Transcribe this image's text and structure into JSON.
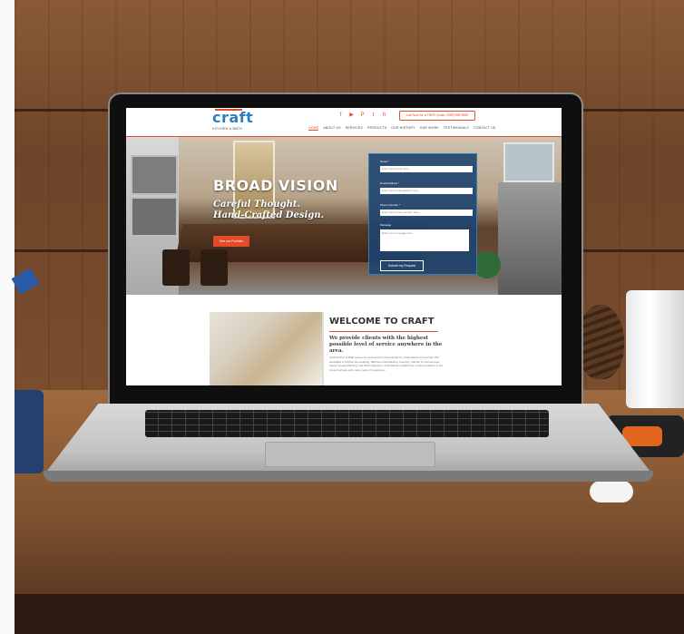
{
  "brand": {
    "name": "craft",
    "subline": "KITCHEN & BATH",
    "accent_color": "#e44b27",
    "logo_color": "#2d7fbf"
  },
  "header": {
    "social_icons": [
      "facebook-icon",
      "youtube-icon",
      "pinterest-icon",
      "twitter-icon",
      "houzz-icon"
    ],
    "social_glyphs": [
      "f",
      "▶",
      "P",
      "t",
      "h"
    ],
    "cta_label": "Call Now for a FREE Quote: (555) 555-5555"
  },
  "nav": {
    "items": [
      "HOME",
      "ABOUT US",
      "SERVICES",
      "PRODUCTS",
      "OUR HISTORY",
      "OUR WORK",
      "TESTIMONIALS",
      "CONTACT US"
    ],
    "active": "HOME"
  },
  "hero": {
    "title": "BROAD VISION",
    "tagline_1": "Careful Thought.",
    "tagline_2": "Hand-Crafted Design.",
    "button_label": "See our Portfolio"
  },
  "quote_form": {
    "fields": [
      {
        "label": "Name *",
        "placeholder": "Enter your name here..."
      },
      {
        "label": "Email Address *",
        "placeholder": "Enter your email address here..."
      },
      {
        "label": "Phone Number *",
        "placeholder": "Enter your phone number here..."
      }
    ],
    "message_label": "Message",
    "message_placeholder": "Enter your message here...",
    "submit_label": "Submit my Request"
  },
  "welcome": {
    "title": "WELCOME TO CRAFT",
    "lead": "We provide clients with the highest possible level of service anywhere in the area.",
    "body": "Craft Kitchen & Bath serves the area and its surroundings for residential & commercial. We specialize in Kitchen Remodeling, Bathroom Remodeling, Flooring, Cabinet & Counter-tops, Interior House Painting, and Deck & Exterior. Craft Kitchen & Bath has a solid reputation in the home business with many years of experience."
  }
}
